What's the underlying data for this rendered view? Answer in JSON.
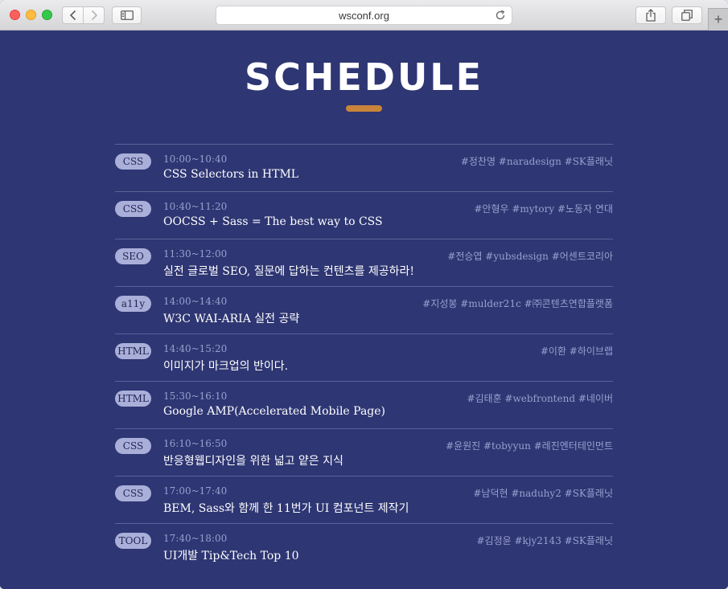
{
  "browser": {
    "url": "wsconf.org",
    "new_tab_label": "+"
  },
  "page": {
    "title": "SCHEDULE",
    "accent_color": "#c9843a",
    "background_color": "#2e3673"
  },
  "sessions": [
    {
      "category": "CSS",
      "time": "10:00~10:40",
      "title": "CSS Selectors in HTML",
      "tags": "#정찬명 #naradesign #SK플래닛"
    },
    {
      "category": "CSS",
      "time": "10:40~11:20",
      "title": "OOCSS + Sass = The best way to CSS",
      "tags": "#안형우 #mytory #노동자 연대"
    },
    {
      "category": "SEO",
      "time": "11:30~12:00",
      "title": "실전 글로벌 SEO, 질문에 답하는 컨텐츠를 제공하라!",
      "tags": "#전승엽 #yubsdesign #어센트코리아"
    },
    {
      "category": "a11y",
      "time": "14:00~14:40",
      "title": "W3C WAI-ARIA 실전 공략",
      "tags": "#지성봉 #mulder21c #㈜콘텐츠연합플랫폼"
    },
    {
      "category": "HTML",
      "time": "14:40~15:20",
      "title": "이미지가 마크업의 반이다.",
      "tags": "#이환 #하이브랩"
    },
    {
      "category": "HTML",
      "time": "15:30~16:10",
      "title": "Google AMP(Accelerated Mobile Page)",
      "tags": "#김태훈 #webfrontend #네이버"
    },
    {
      "category": "CSS",
      "time": "16:10~16:50",
      "title": "반응형웹디자인을 위한 넓고 얕은 지식",
      "tags": "#윤원진 #tobyyun #레진엔터테인먼트"
    },
    {
      "category": "CSS",
      "time": "17:00~17:40",
      "title": "BEM, Sass와 함께 한 11번가 UI 컴포넌트 제작기",
      "tags": "#남덕현 #naduhy2 #SK플래닛"
    },
    {
      "category": "TOOL",
      "time": "17:40~18:00",
      "title": "UI개발 Tip&Tech Top 10",
      "tags": "#김정윤 #kjy2143 #SK플래닛"
    }
  ]
}
